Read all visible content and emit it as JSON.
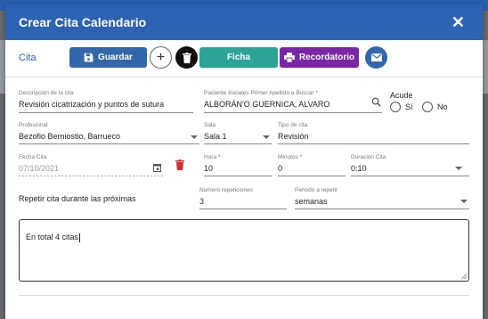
{
  "dialog": {
    "title": "Crear Cita Calendario",
    "close": "✕"
  },
  "toolbar": {
    "section": "Cita",
    "guardar": "Guardar",
    "add": "+",
    "ficha": "Ficha",
    "recordatorio": "Recordatorio"
  },
  "fields": {
    "descripcion": {
      "label": "Descripción de la cita",
      "value": "Revisión cicatrización y puntos de sutura"
    },
    "paciente": {
      "label": "Paciente Iniciales Primer Apellido a Buscar *",
      "value": "ALBORÁN'O GUERNICA, ALVARO"
    },
    "acude": {
      "label": "Acude",
      "si": "Sí",
      "no": "No"
    },
    "profesional": {
      "label": "Profesional",
      "value": "Bezofio Berniostio, Barrueco"
    },
    "sala": {
      "label": "Sala",
      "value": "Sala 1"
    },
    "tipo": {
      "label": "Tipo de cita",
      "value": "Revisión"
    },
    "fecha": {
      "label": "Fecha Cita",
      "value": "07/10/2021"
    },
    "hora": {
      "label": "Hora *",
      "value": "10"
    },
    "minutos": {
      "label": "Minutos *",
      "value": "0"
    },
    "duracion": {
      "label": "Duración Cita",
      "value": "0:10"
    },
    "repetir": {
      "label": "Repetir cita durante las próximas"
    },
    "repeticiones": {
      "label": "Numero repeticiones",
      "value": "3"
    },
    "periodo": {
      "label": "Periodo a repetir",
      "value": "semanas"
    },
    "nota": {
      "value": "En total 4 citas"
    }
  },
  "colors": {
    "header": "#2c63b2",
    "ficha": "#2ba496",
    "recordatorio": "#7a24a6",
    "delete_icon": "#d32f2f"
  }
}
